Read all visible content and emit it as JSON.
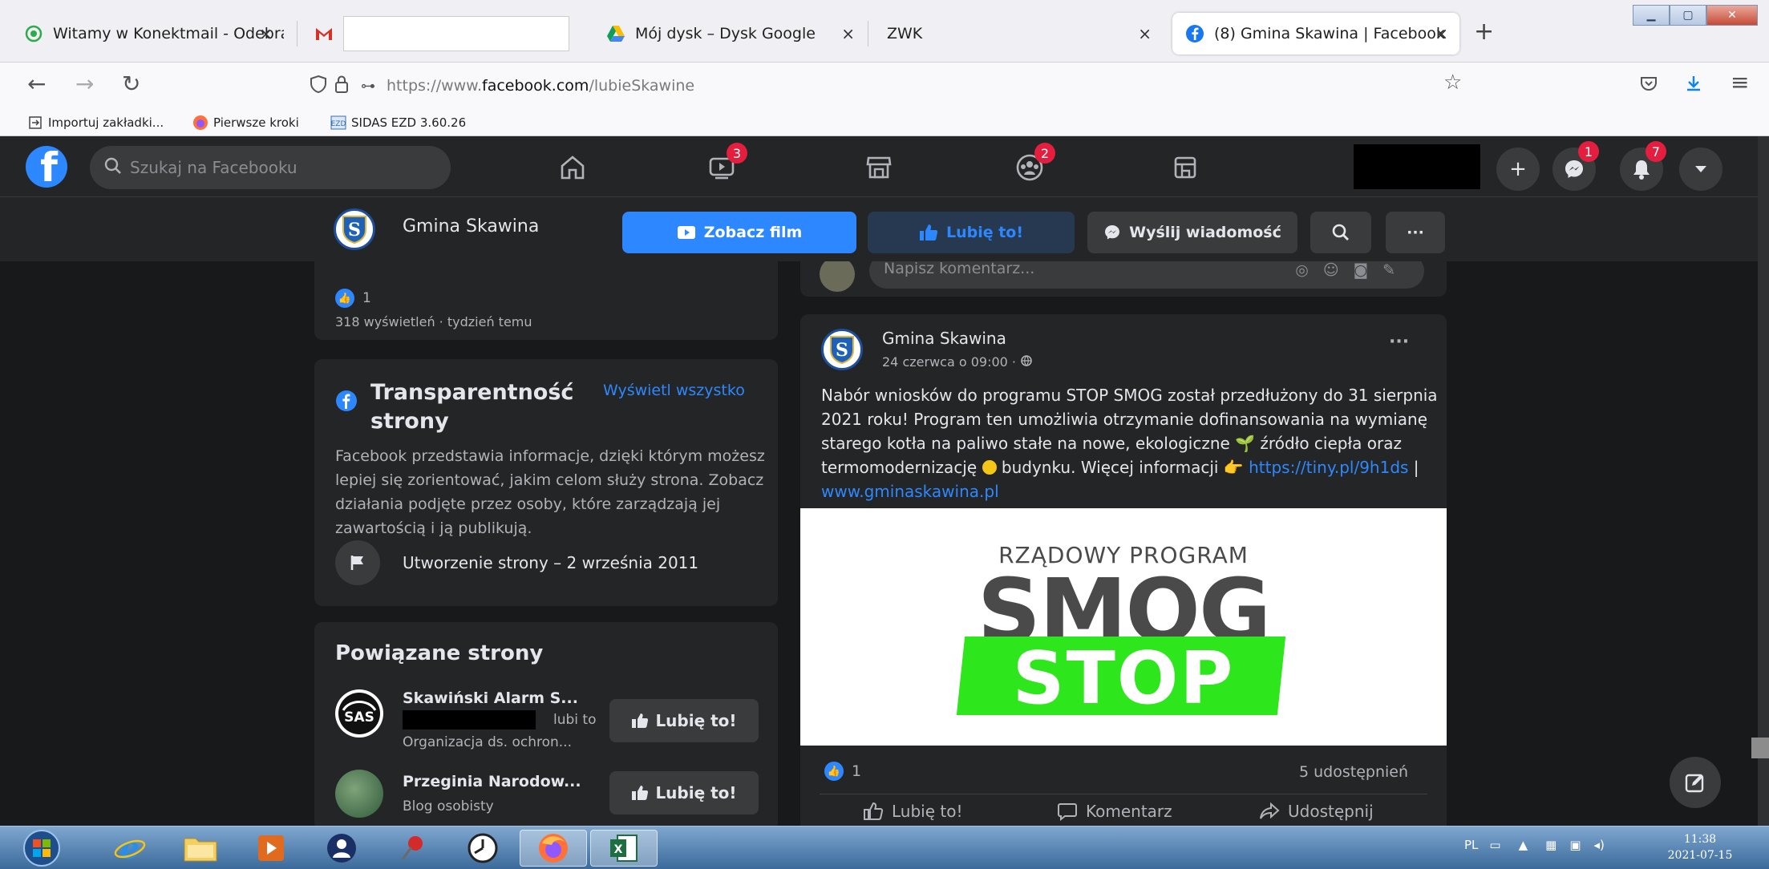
{
  "browser": {
    "tabs": [
      {
        "title": "Witamy w Konektmail - Odebra",
        "icon": "konektmail-icon"
      },
      {
        "title": "",
        "icon": "gmail-icon"
      },
      {
        "title": "Mój dysk – Dysk Google",
        "icon": "google-drive-icon"
      },
      {
        "title": "ZWK",
        "icon": ""
      },
      {
        "title": "(8) Gmina Skawina | Facebook",
        "icon": "facebook-icon",
        "active": true
      }
    ],
    "close_glyph": "×",
    "newtab_glyph": "+",
    "url_prefix": "https://www.",
    "url_host": "facebook.com",
    "url_path": "/lubieSkawine",
    "bookmarks": [
      {
        "label": "Importuj zakładki...",
        "icon": "import-icon"
      },
      {
        "label": "Pierwsze kroki",
        "icon": "firefox-icon"
      },
      {
        "label": "SIDAS EZD 3.60.26",
        "icon": "sidas-icon"
      }
    ]
  },
  "facebook": {
    "search_placeholder": "Szukaj na Facebooku",
    "badges": {
      "watch": "3",
      "groups": "2",
      "messenger": "1",
      "notifications": "7"
    }
  },
  "page_header": {
    "name": "Gmina Skawina",
    "watch_label": "Zobacz film",
    "like_label": "Lubię to!",
    "message_label": "Wyślij wiadomość",
    "more_glyph": "···"
  },
  "left": {
    "prev_post_like_count": "1",
    "prev_post_meta": "318 wyświetleń · tydzień temu",
    "transparency": {
      "title": "Transparentność strony",
      "see_all": "Wyświetl wszystko",
      "text": "Facebook przedstawia informacje, dzięki którym możesz lepiej się zorientować, jakim celom służy strona. Zobacz działania podjęte przez osoby, które zarządzają jej zawartością i ją publikują.",
      "created": "Utworzenie strony – 2 września 2011"
    },
    "related": {
      "title": "Powiązane strony",
      "items": [
        {
          "name": "Skawiński Alarm S...",
          "likes_suffix": "lubi to",
          "category": "Organizacja ds. ochron...",
          "button": "Lubię to!"
        },
        {
          "name": "Przeginia Narodow...",
          "category": "Blog osobisty",
          "button": "Lubię to!"
        }
      ]
    }
  },
  "post": {
    "comment_placeholder": "Napisz komentarz...",
    "author": "Gmina Skawina",
    "date": "24 czerwca o 09:00 ·",
    "more_glyph": "···",
    "text_1": "Nabór wniosków  do programu STOP SMOG został przedłużony do 31 sierpnia 2021 roku! Program ten umożliwia otrzymanie dofinansowania na wymianę starego kotła na paliwo stałe na nowe, ekologiczne ",
    "text_2": " źródło ciepła oraz termomodernizację ",
    "text_3": " budynku. Więcej informacji ",
    "link_1": "https://tiny.pl/9h1ds",
    "separator": " | ",
    "link_2": "www.gminaskawina.pl",
    "image": {
      "line1": "RZĄDOWY PROGRAM",
      "line2": "SMOG",
      "line3": "STOP"
    },
    "like_count": "1",
    "shares": "5 udostępnień",
    "actions": {
      "like": "Lubię to!",
      "comment": "Komentarz",
      "share": "Udostępnij"
    }
  },
  "taskbar": {
    "lang": "PL",
    "time": "11:38",
    "date": "2021-07-15"
  }
}
